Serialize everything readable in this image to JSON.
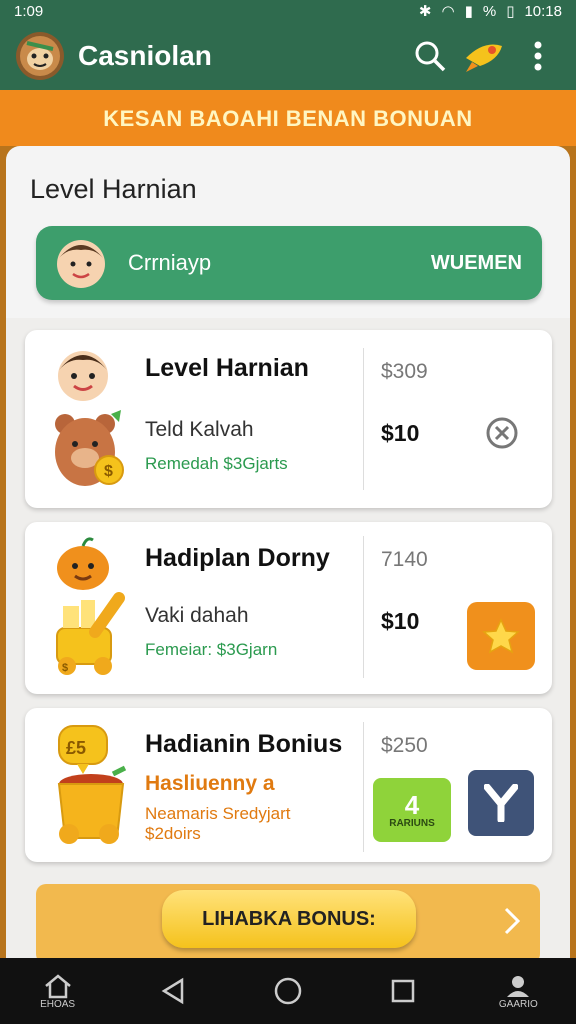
{
  "status": {
    "left": "1:09",
    "right_text": "%",
    "time": "10:18"
  },
  "appbar": {
    "title": "Casniolan",
    "logo_icon": "sloth-avatar-icon",
    "search_icon": "search-icon",
    "rocket_icon": "rocket-icon",
    "menu_icon": "more-vert-icon"
  },
  "banner": {
    "text": "KESAN BAOAHI BENAN BONUAN"
  },
  "panel": {
    "heading": "Level Harnian",
    "strip": {
      "name": "Crrniayp",
      "tag": "WUEMEN"
    }
  },
  "cards": [
    {
      "title": "Level Harnian",
      "subtitle": "Teld Kalvah",
      "footer": "Remedah $3Gjarts",
      "price_top": "$309",
      "price_main": "$10",
      "action_icon": "close-circle-icon"
    },
    {
      "title": "Hadiplan Dorny",
      "subtitle": "Vaki dahah",
      "footer": "Femeiar: $3Gjarn",
      "price_top": "7140",
      "price_main": "$10",
      "action_icon": "star-icon"
    },
    {
      "title": "Hadianin Bonius",
      "subtitle": "Hasliuenny a",
      "footer": "Neamaris Sredyjart",
      "footer2": "$2doirs",
      "price_top": "$250",
      "btn_green": {
        "num": "4",
        "label": "RARIUNS"
      },
      "action_icon": "y-logo-icon"
    }
  ],
  "bonus": {
    "label": "LIHABKA BONUS:"
  },
  "nav": {
    "home": "EHOAS",
    "profile": "GAARIO"
  },
  "colors": {
    "green": "#2f6b4e",
    "orange": "#f08a1c",
    "strip": "#3d9e6c",
    "gold": "#f5c21c"
  }
}
